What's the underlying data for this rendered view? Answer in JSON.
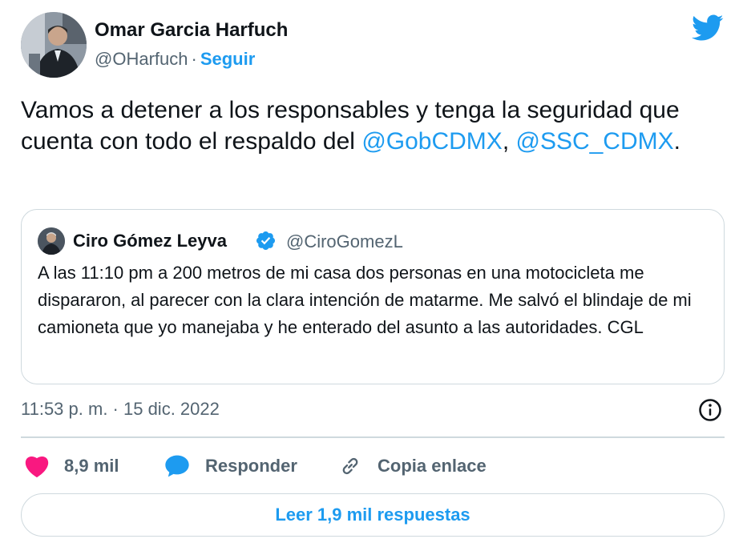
{
  "tweet": {
    "author": {
      "name": "Omar Garcia Harfuch",
      "handle": "@OHarfuch",
      "separator": "·",
      "follow_label": "Seguir"
    },
    "text_before": "Vamos a detener a los responsables y tenga la seguridad que cuenta con todo el respaldo del ",
    "mention_1": "@GobCDMX",
    "text_between": ", ",
    "mention_2": "@SSC_CDMX",
    "text_after": ".",
    "quote": {
      "author_name": "Ciro Gómez Leyva",
      "verified": true,
      "handle": "@CiroGomezL",
      "text": "A las 11:10 pm a 200 metros de mi casa dos personas en una motocicleta me dispararon, al parecer con la clara intención de matarme. Me salvó el blindaje de mi camioneta que yo manejaba y he enterado del asunto a las autoridades. CGL"
    },
    "timestamp": "11:53 p. m. · 15 dic. 2022",
    "actions": {
      "likes": "8,9 mil",
      "reply_label": "Responder",
      "copy_label": "Copia enlace"
    },
    "read_replies_label": "Leer 1,9 mil respuestas"
  },
  "icons": {
    "brand": "twitter-bird-icon",
    "info": "info-icon",
    "like": "heart-icon",
    "reply": "speech-bubble-icon",
    "copy": "link-icon",
    "verified": "verified-badge-icon"
  },
  "colors": {
    "brand_blue": "#1d9bf0",
    "like_pink": "#f91880",
    "text_primary": "#0f1419",
    "text_secondary": "#536471",
    "border": "#cfd9de"
  }
}
